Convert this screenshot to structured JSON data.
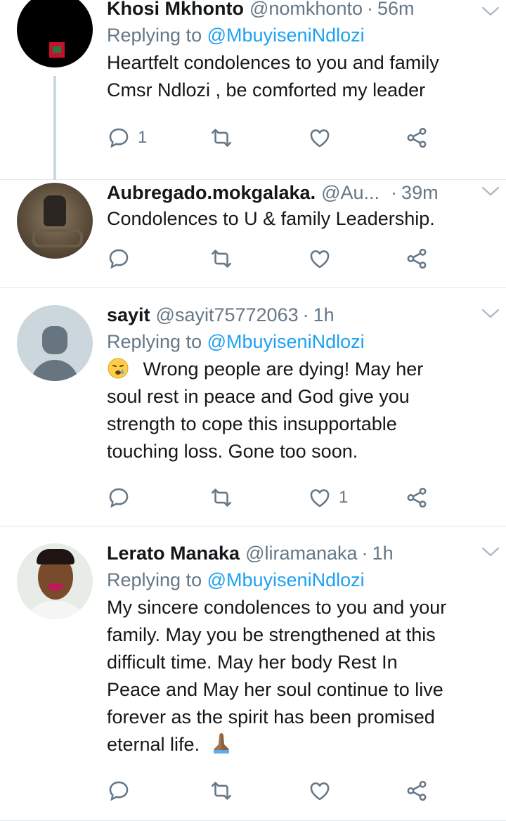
{
  "tweets": [
    {
      "name": "Khosi Mkhonto",
      "handle": "@nomkhonto",
      "dot": "·",
      "time": "56m",
      "replying_prefix": "Replying to",
      "replying_to": "@MbuyiseniNdlozi",
      "text_lines": [
        "Heartfelt condolences to you and family",
        "Cmsr Ndlozi , be comforted my leader"
      ],
      "reply_count": "1",
      "like_count": ""
    },
    {
      "name": "Aubregado.mokgalaka.",
      "handle": "@Au...",
      "dot": "·",
      "time": "39m",
      "text_lines": [
        "Condolences to U & family Leadership."
      ],
      "reply_count": "",
      "like_count": ""
    },
    {
      "name": "sayit",
      "handle": "@sayit75772063",
      "dot": "·",
      "time": "1h",
      "replying_prefix": "Replying to",
      "replying_to": "@MbuyiseniNdlozi",
      "text_first": "Wrong people are dying! May her",
      "text_lines": [
        "soul rest in peace and God give you",
        "strength to cope this insupportable",
        "touching loss. Gone too soon."
      ],
      "reply_count": "",
      "like_count": "1"
    },
    {
      "name": "Lerato Manaka",
      "handle": "@liramanaka",
      "dot": "·",
      "time": "1h",
      "replying_prefix": "Replying to",
      "replying_to": "@MbuyiseniNdlozi",
      "text_lines": [
        "My sincere condolences to you and your",
        "family. May you be strengthened at this",
        "difficult time. May her body Rest In",
        "Peace and May her soul continue to live",
        "forever as the spirit has been promised"
      ],
      "text_last": "eternal life.",
      "reply_count": "",
      "like_count": ""
    }
  ],
  "icons": [
    "chevron-down-icon",
    "reply-icon",
    "retweet-icon",
    "like-icon",
    "share-icon",
    "crying-face-emoji-icon",
    "folded-hands-emoji-icon"
  ],
  "colors": {
    "link": "#1da1f2",
    "muted": "#657786",
    "divider": "#e1e8ed"
  }
}
